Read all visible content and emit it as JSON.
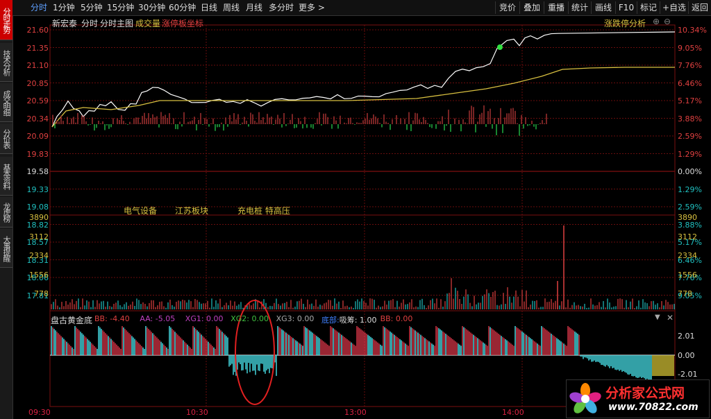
{
  "sidebar": {
    "tabs": [
      {
        "label": "分时走势",
        "active": true
      },
      {
        "label": "技术分析",
        "active": false
      },
      {
        "label": "成交明细",
        "active": false
      },
      {
        "label": "分价表",
        "active": false
      },
      {
        "label": "基本资料",
        "active": false
      },
      {
        "label": "龙虎榜",
        "active": false
      },
      {
        "label": "大事提醒",
        "active": false
      }
    ]
  },
  "toolbar": {
    "periods": [
      "分时",
      "1分钟",
      "5分钟",
      "15分钟",
      "30分钟",
      "60分钟",
      "日线",
      "周线",
      "月线",
      "多分时",
      "更多 >"
    ],
    "active_period": "分时",
    "buttons": [
      "竞价",
      "叠加",
      "重播",
      "统计",
      "画线",
      "F10",
      "标记",
      "+自选",
      "返回"
    ]
  },
  "main_chart": {
    "stock_name": "新宏泰",
    "view_label": "分时",
    "main_chart_label": "分时主图",
    "volume_label": "成交量",
    "limit_coord_label": "涨停板坐标",
    "limit_analysis": "涨跌停分析",
    "price_ticks": [
      "21.60",
      "21.35",
      "21.10",
      "20.85",
      "20.59",
      "20.34",
      "20.09",
      "19.83",
      "19.58",
      "19.33",
      "19.08",
      "18.82",
      "18.57",
      "18.31",
      "18.06",
      "17.81"
    ],
    "pct_ticks": [
      "10.34%",
      "9.05%",
      "7.76%",
      "6.46%",
      "5.17%",
      "3.88%",
      "2.59%",
      "1.29%",
      "0.00%",
      "1.29%",
      "2.59%",
      "3.88%",
      "5.17%",
      "6.46%",
      "7.76%",
      "9.05%"
    ],
    "tags": [
      "电气设备",
      "江苏板块",
      "充电桩 特高压"
    ],
    "colors": {
      "up": "#e04040",
      "down": "#20c0c0",
      "price_line": "#ffffff",
      "avg_line": "#d8c040",
      "grid": "#7a1010"
    }
  },
  "volume_chart": {
    "ticks": [
      "3890",
      "3112",
      "2334",
      "1556",
      "778"
    ]
  },
  "indicator": {
    "name": "盘古黄金底",
    "params": [
      {
        "label": "BB: -4.40",
        "color": "#e04040"
      },
      {
        "label": "AA: -5.05",
        "color": "#c040c0"
      },
      {
        "label": "XG1: 0.00",
        "color": "#c040c0"
      },
      {
        "label": "XG2: 0.00",
        "color": "#40c040"
      },
      {
        "label": "XG3: 0.00",
        "color": "#aaaaaa"
      },
      {
        "label": "底部:",
        "color": "#4080ff"
      },
      {
        "label": "吸筹: 1.00",
        "color": "#dddddd"
      },
      {
        "label": "BB: 0.00",
        "color": "#e04040"
      }
    ],
    "ticks": [
      "2.01",
      "0.00",
      "-2.01"
    ]
  },
  "time_axis": [
    "09:30",
    "10:30",
    "13:00",
    "14:00"
  ],
  "watermark": {
    "brand": "分析家公式网",
    "url": "www.70822.com"
  }
}
